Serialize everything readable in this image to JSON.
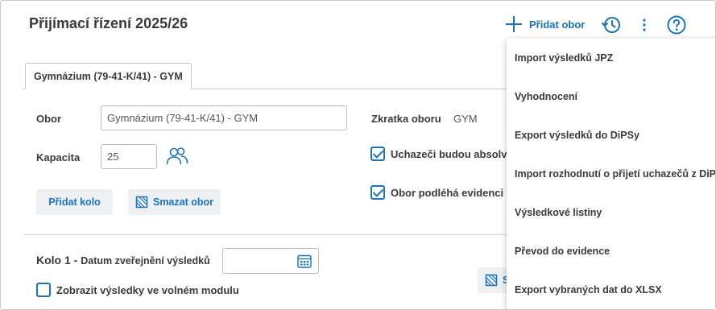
{
  "header": {
    "title": "Přijímací řízení 2025/26",
    "add_label": "Přidat obor",
    "accent": "#1a73b8"
  },
  "tabs": [
    {
      "label": "Gymnázium (79-41-K/41) - GYM"
    }
  ],
  "form": {
    "obor_label": "Obor",
    "obor_value": "Gymnázium (79-41-K/41) - GYM",
    "kapacita_label": "Kapacita",
    "kapacita_value": "25",
    "zkratka_label": "Zkratka oboru",
    "zkratka_value": "GYM",
    "check1_label": "Uchazeči budou absolvo",
    "check2_label": "Obor podléhá evidenci v",
    "add_round_label": "Přidat kolo",
    "delete_label": "Smazat obor"
  },
  "round": {
    "title": "Kolo 1 -",
    "date_label": "Datum zveřejnění výsledků",
    "date_value": "",
    "show_label": "Zobrazit výsledky ve volném modulu",
    "partial_button": "S"
  },
  "menu": {
    "items": [
      "Import výsledků JPZ",
      "Vyhodnocení",
      "Export výsledků do DiPSy",
      "Import rozhodnutí o přijetí uchazečů z DiPSy",
      "Výsledkové listiny",
      "Převod do evidence",
      "Export vybraných dat do XLSX"
    ]
  },
  "icons": {
    "add": "plus-icon",
    "history": "history-icon",
    "more": "kebab-icon",
    "help": "help-icon",
    "users": "users-icon",
    "delete": "delete-icon",
    "calendar": "calendar-icon"
  }
}
